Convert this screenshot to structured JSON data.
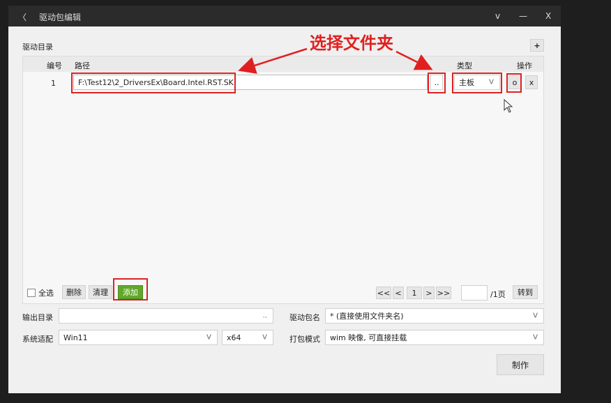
{
  "window": {
    "back_glyph": "〈",
    "title": "驱动包编辑",
    "controls": {
      "dropdown": "v",
      "minimize": "—",
      "close": "X"
    }
  },
  "driver_dir": {
    "section_label": "驱动目录",
    "add_plus": "+",
    "headers": {
      "num": "编号",
      "path": "路径",
      "type": "类型",
      "action": "操作"
    },
    "rows": [
      {
        "num": "1",
        "path": "F:\\Test12\\2_DriversEx\\Board.Intel.RST.SK",
        "browse": "..",
        "type": "主板",
        "type_chevron": "V",
        "open": "o",
        "remove": "x"
      }
    ]
  },
  "annotation": {
    "text": "选择文件夹",
    "color": "#e02020"
  },
  "footer": {
    "select_all": "全选",
    "delete": "删除",
    "clear": "清理",
    "add": "添加",
    "pager": {
      "first": "<<",
      "prev": "<",
      "current": "1",
      "next": ">",
      "last": ">>",
      "page_input": "",
      "total": "/1页",
      "goto": "转到"
    }
  },
  "form": {
    "output_label": "输出目录",
    "output_value": "",
    "output_browse": "..",
    "pkgname_label": "驱动包名",
    "pkgname_value": "* (直接使用文件夹名)",
    "system_label": "系统适配",
    "system_value": "Win11",
    "arch_value": "x64",
    "mode_label": "打包模式",
    "mode_value": "wim 映像, 可直接挂载",
    "chevron": "V",
    "make": "制作"
  },
  "colors": {
    "accent_green": "#62a82a",
    "annotation_red": "#d22222"
  }
}
